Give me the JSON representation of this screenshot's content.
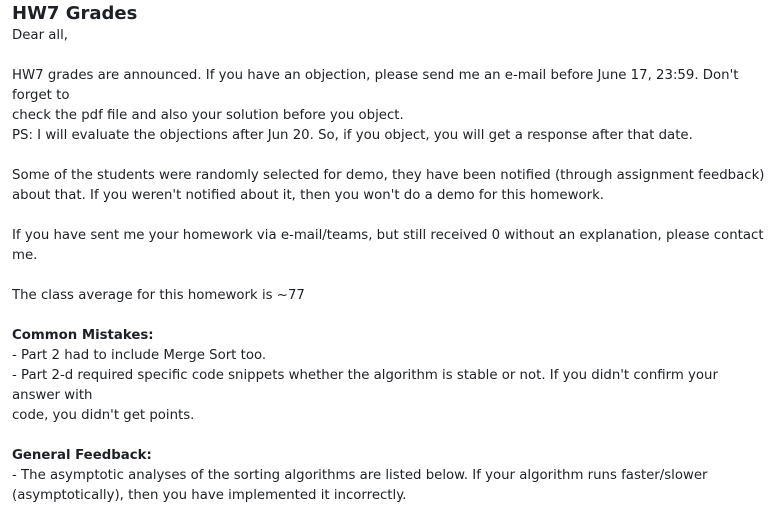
{
  "post": {
    "title": "HW7 Grades",
    "greeting": "Dear all,",
    "announcement": {
      "line1": "HW7 grades are announced. If you have an objection, please send me an e-mail before June 17, 23:59. Don't forget to",
      "line2": "check the pdf file and also your solution before you object.",
      "line3": "PS: I will evaluate the objections after Jun 20. So, if you object, you will get a response after that date."
    },
    "demo": {
      "line1": "Some of the students were randomly selected for demo, they have been notified (through assignment feedback)",
      "line2": "about that. If you weren't notified about it, then you won't do a demo for this homework."
    },
    "contact": "If you have sent me your homework via e-mail/teams, but still received 0 without an explanation, please contact me.",
    "average": "The class average for this homework is ~77",
    "common_mistakes": {
      "heading": "Common Mistakes:",
      "item1": "- Part 2 had to include Merge Sort too.",
      "item2_line1": "- Part 2-d required specific code snippets whether the algorithm is stable or not. If you didn't confirm your answer with",
      "item2_line2": "code, you didn't get points."
    },
    "general_feedback": {
      "heading": "General Feedback:",
      "item1_line1": "- The asymptotic analyses of the sorting algorithms are listed below. If your algorithm runs faster/slower",
      "item1_line2": "(asymptotically), then you have implemented it incorrectly."
    }
  }
}
